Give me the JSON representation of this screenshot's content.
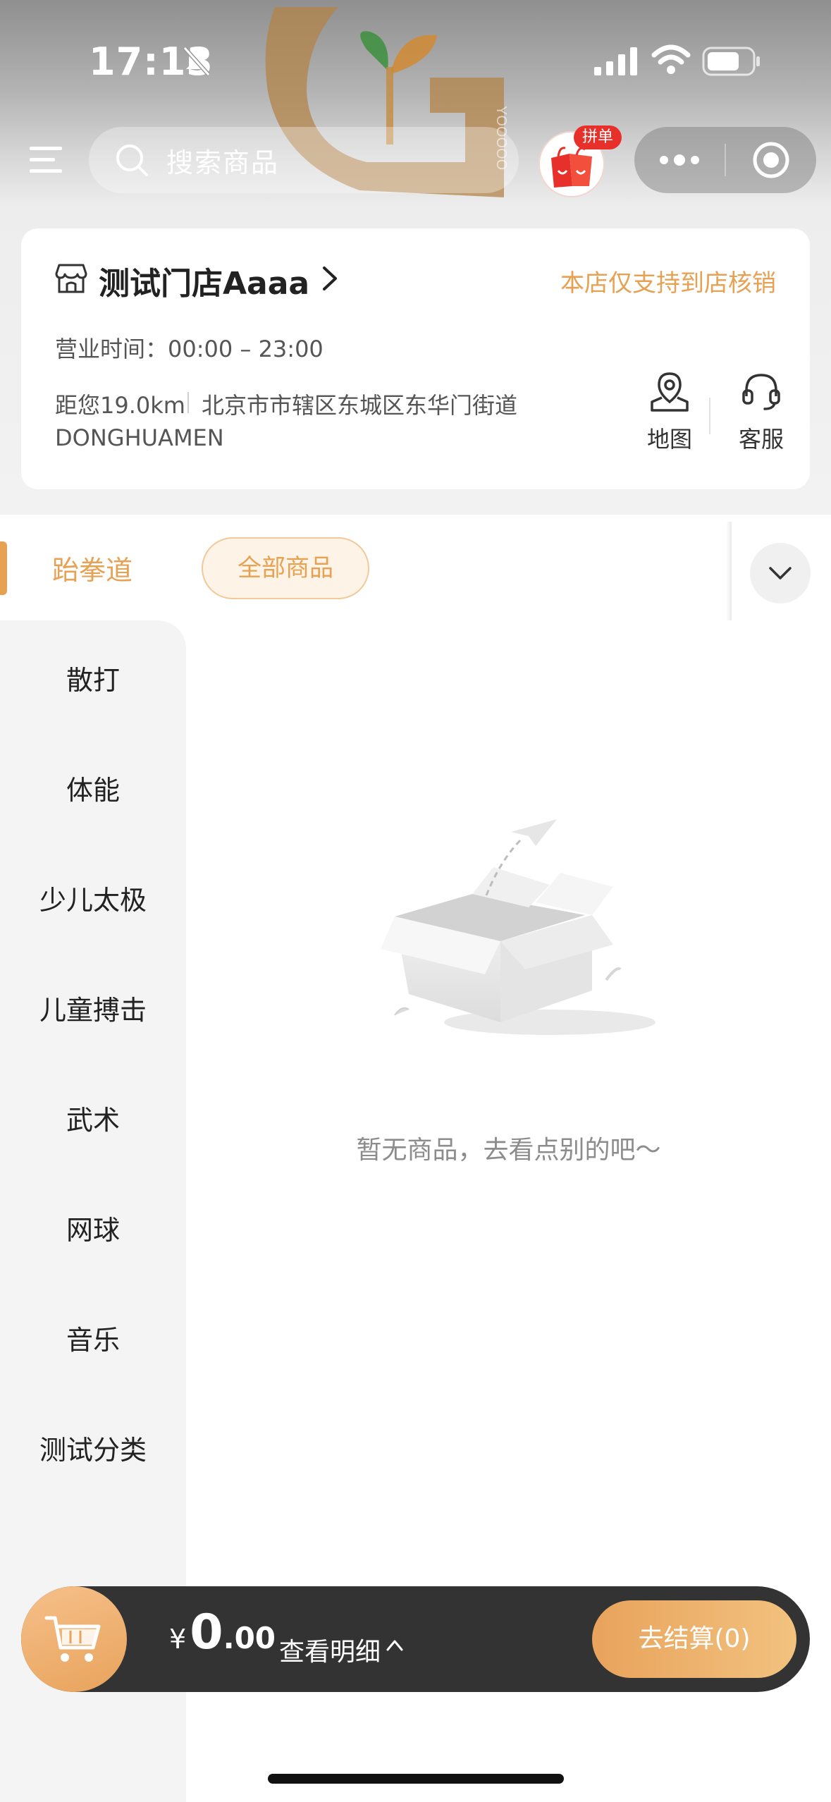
{
  "status_bar": {
    "time": "17:13"
  },
  "header": {
    "search_placeholder": "搜索商品",
    "groupbuy_badge": "拼单",
    "watermark_text": "YOOOOO"
  },
  "store": {
    "name": "测试门店Aaaa",
    "notice": "本店仅支持到店核销",
    "hours": "营业时间：00:00 – 23:00",
    "distance": "距您19.0km",
    "address_line1": "北京市市辖区东城区东华门街道",
    "address_line2": "DONGHUAMEN",
    "map_label": "地图",
    "service_label": "客服"
  },
  "category": {
    "active": "跆拳道",
    "chip_all": "全部商品"
  },
  "sidebar": {
    "items": [
      {
        "label": "散打"
      },
      {
        "label": "体能"
      },
      {
        "label": "少儿太极"
      },
      {
        "label": "儿童搏击"
      },
      {
        "label": "武术"
      },
      {
        "label": "网球"
      },
      {
        "label": "音乐"
      },
      {
        "label": "测试分类"
      }
    ]
  },
  "empty_state": {
    "text": "暂无商品，去看点别的吧～"
  },
  "cart": {
    "currency": "¥",
    "price_integer": "0",
    "price_decimal": ".00",
    "detail_label": "查看明细",
    "checkout_label": "去结算(0)"
  },
  "colors": {
    "accent": "#e7a153",
    "cart_bar": "#333333",
    "badge": "#e8302a"
  }
}
